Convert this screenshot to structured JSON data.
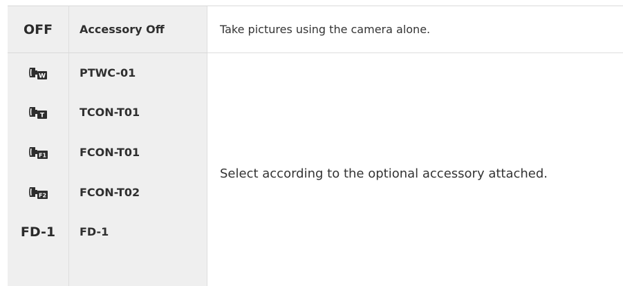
{
  "table": {
    "rows": [
      {
        "symbol_text": "OFF",
        "name": "Accessory Off"
      },
      {
        "symbol_icon": "converter-w-icon",
        "name": "PTWC-01",
        "badge": "W"
      },
      {
        "symbol_icon": "converter-t-icon",
        "name": "TCON-T01",
        "badge": "T"
      },
      {
        "symbol_icon": "converter-f1-icon",
        "name": "FCON-T01",
        "badge": "F1"
      },
      {
        "symbol_icon": "converter-f2-icon",
        "name": "FCON-T02",
        "badge": "F2"
      },
      {
        "symbol_text": "FD-1",
        "name": "FD-1"
      }
    ],
    "description_off": "Take pictures using the camera alone.",
    "description_accessory": "Select according to the optional accessory attached."
  }
}
